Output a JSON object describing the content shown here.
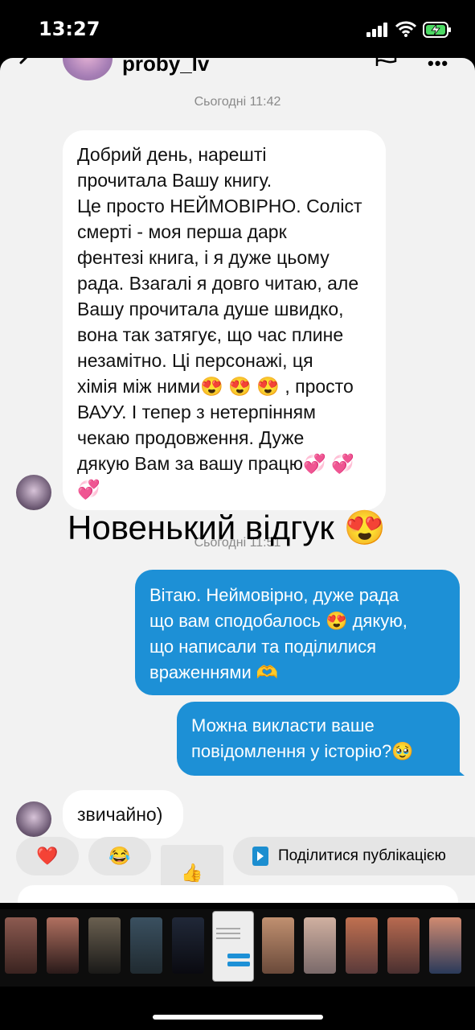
{
  "status_bar": {
    "time": "13:27"
  },
  "header": {
    "username": "proby_lv"
  },
  "messages": {
    "timestamp_1": "Сьогодні 11:42",
    "timestamp_2": "Сьогодні 11:51",
    "incoming_1": "Добрий день, нарешті прочитала Вашу книгу.\nЦе просто НЕЙМОВІРНО. Соліст смерті - моя перша дарк фентезі книга, і я дуже цьому рада. Взагалі я довго читаю, але Вашу прочитала душе швидко, вона так затягує, що час плине незамітно. Ці персонажі, ця хімія між ними😍 😍 😍 , просто ВАУУ. І тепер з нетерпінням чекаю продовження. Дуже дякую Вам за вашу працю💞 💞 💞",
    "outgoing_1": "Вітаю. Неймовірно, дуже рада що вам сподобалось 😍 дякую, що написали та поділилися враженнями 🫶",
    "outgoing_2": "Можна викласти ваше повідомлення у історію?🥹",
    "incoming_2": "звичайно)"
  },
  "overlay": {
    "caption": "Новенький відгук 😍"
  },
  "reactions": {
    "heart": "❤️",
    "laugh": "😂",
    "thumbs_up": "👍",
    "share_label": "Поділитися публікацією"
  },
  "colors": {
    "outgoing_bubble": "#1d90d6",
    "incoming_bubble": "#ffffff",
    "sheet_background": "#f2f2f2",
    "battery_fill": "#4cd964"
  }
}
